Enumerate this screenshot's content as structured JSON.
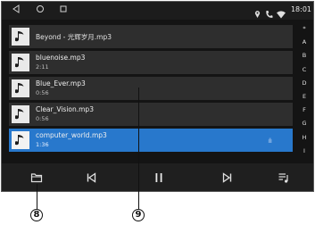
{
  "status_bar": {
    "nav_icons": [
      "back-icon",
      "home-icon",
      "recents-icon"
    ],
    "status_icons": [
      "location-icon",
      "phone-icon",
      "wifi-icon"
    ],
    "time": "18:01"
  },
  "playlist": {
    "items": [
      {
        "name": "Beyond - 光辉岁月.mp3",
        "duration": ""
      },
      {
        "name": "bluenoise.mp3",
        "duration": "2:11"
      },
      {
        "name": "Blue_Ever.mp3",
        "duration": "0:56"
      },
      {
        "name": "Clear_Vision.mp3",
        "duration": "0:56"
      },
      {
        "name": "computer_world.mp3",
        "duration": "1:36",
        "selected": true
      }
    ],
    "playing_indicator": "ıllı"
  },
  "alphabet_index": [
    "*",
    "A",
    "B",
    "C",
    "D",
    "E",
    "F",
    "G",
    "H",
    "I"
  ],
  "controls": [
    "folder-icon",
    "previous-icon",
    "pause-icon",
    "next-icon",
    "playlist-icon"
  ],
  "callouts": {
    "left": "8",
    "right": "9"
  },
  "colors": {
    "background": "#141414",
    "row": "#2e2e2e",
    "selected_row": "#2878cc",
    "control_bar": "#1f1f1f"
  }
}
